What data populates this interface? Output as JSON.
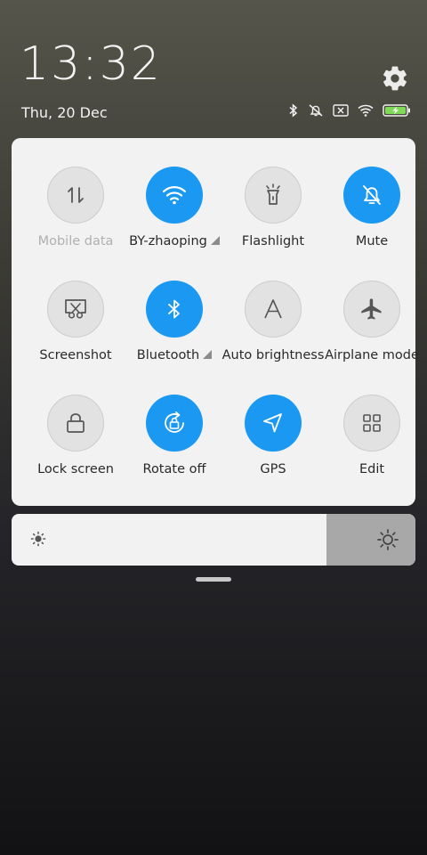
{
  "status_bar": {
    "time": "13:32",
    "date": "Thu, 20 Dec",
    "icons": [
      "bluetooth-icon",
      "mute-icon",
      "sim-off-icon",
      "wifi-icon",
      "battery-charging-icon"
    ]
  },
  "colors": {
    "accent": "#1a98f2",
    "panel_bg": "#f2f2f2",
    "tile_off": "#e2e2e2",
    "battery": "#7ed957"
  },
  "toggles": [
    {
      "label": "Mobile data",
      "icon": "mobile-data-icon",
      "active": false
    },
    {
      "label": "BY-zhaoping",
      "icon": "wifi-icon",
      "active": true
    },
    {
      "label": "Flashlight",
      "icon": "flashlight-icon",
      "active": false
    },
    {
      "label": "Mute",
      "icon": "bell-off-icon",
      "active": true
    },
    {
      "label": "Screenshot",
      "icon": "screenshot-icon",
      "active": false
    },
    {
      "label": "Bluetooth",
      "icon": "bluetooth-icon",
      "active": true
    },
    {
      "label": "Auto brightness",
      "icon": "auto-brightness-icon",
      "active": false
    },
    {
      "label": "Airplane mode",
      "icon": "airplane-icon",
      "active": false
    },
    {
      "label": "Lock screen",
      "icon": "lock-icon",
      "active": false
    },
    {
      "label": "Rotate off",
      "icon": "rotate-lock-icon",
      "active": true
    },
    {
      "label": "GPS",
      "icon": "location-arrow-icon",
      "active": true
    },
    {
      "label": "Edit",
      "icon": "grid-icon",
      "active": false
    }
  ],
  "brightness": {
    "level": 0.78
  }
}
